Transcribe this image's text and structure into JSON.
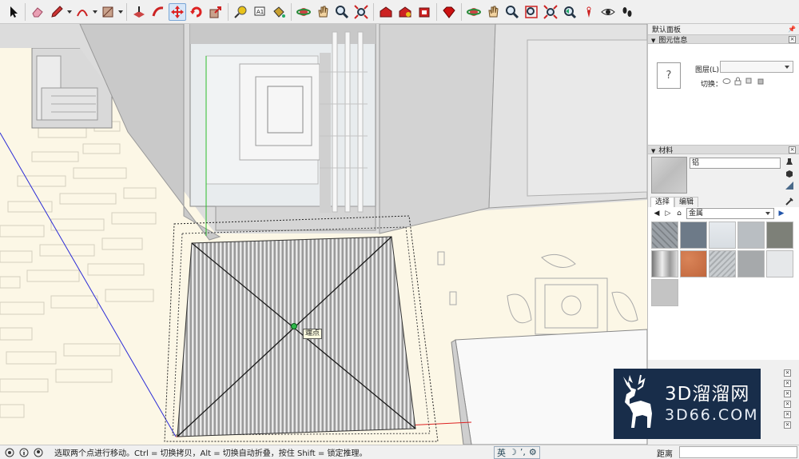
{
  "toolbar": {
    "tools": [
      {
        "name": "select-tool",
        "icon": "cursor-arrow-icon"
      },
      {
        "name": "eraser-tool",
        "icon": "eraser-icon"
      },
      {
        "name": "pencil-tool",
        "icon": "pencil-icon"
      },
      {
        "name": "arc-tool",
        "icon": "arc-icon"
      },
      {
        "name": "shape-tool",
        "icon": "rectangle-icon"
      },
      {
        "name": "push-pull-tool",
        "icon": "push-pull-icon"
      },
      {
        "name": "follow-me-tool",
        "icon": "follow-me-icon"
      },
      {
        "name": "move-tool",
        "icon": "move-arrows-icon",
        "active": true
      },
      {
        "name": "rotate-tool",
        "icon": "rotate-icon"
      },
      {
        "name": "scale-tool",
        "icon": "scale-icon"
      },
      {
        "name": "tape-measure-tool",
        "icon": "tape-measure-icon"
      },
      {
        "name": "text-tool",
        "icon": "text-label-icon"
      },
      {
        "name": "paint-bucket-tool",
        "icon": "paint-bucket-icon"
      },
      {
        "name": "orbit-tool",
        "icon": "orbit-icon"
      },
      {
        "name": "pan-tool",
        "icon": "hand-pan-icon"
      },
      {
        "name": "zoom-tool",
        "icon": "magnifier-icon"
      },
      {
        "name": "zoom-extents-tool",
        "icon": "zoom-extents-icon"
      },
      {
        "name": "warehouse-tool",
        "icon": "warehouse-icon"
      },
      {
        "name": "share-model-tool",
        "icon": "share-model-icon"
      },
      {
        "name": "extension-tool",
        "icon": "extension-icon"
      },
      {
        "name": "ruby-tool",
        "icon": "ruby-gem-icon"
      },
      {
        "name": "orbit-tool-2",
        "icon": "orbit-icon"
      },
      {
        "name": "pan-tool-2",
        "icon": "hand-pan-icon"
      },
      {
        "name": "zoom-tool-2",
        "icon": "magnifier-icon"
      },
      {
        "name": "zoom-window-tool",
        "icon": "zoom-window-icon"
      },
      {
        "name": "zoom-extents-tool-2",
        "icon": "zoom-extents-icon"
      },
      {
        "name": "previous-view-tool",
        "icon": "previous-view-icon"
      },
      {
        "name": "position-camera-tool",
        "icon": "position-camera-icon"
      },
      {
        "name": "look-around-tool",
        "icon": "eye-icon"
      },
      {
        "name": "walk-tool",
        "icon": "footprints-icon"
      }
    ]
  },
  "viewport": {
    "tooltip": "端点"
  },
  "panel": {
    "title": "默认面板",
    "entity_info": {
      "header": "图元信息",
      "thumb_symbol": "?",
      "layer_label": "图层(L):",
      "layer_value": "",
      "toggle_label": "切换："
    },
    "materials": {
      "header": "材料",
      "material_name": "铝",
      "tabs": [
        {
          "label": "选择",
          "active": true
        },
        {
          "label": "编辑",
          "active": false
        }
      ],
      "library": "金属",
      "swatches": [
        {
          "color": "#9aa0a6",
          "pattern": "diamond-plate"
        },
        {
          "color": "#6d7a88",
          "pattern": "denim-metal"
        },
        {
          "color": "#d8dde2",
          "pattern": "brushed"
        },
        {
          "color": "#b9bec2",
          "pattern": "plain"
        },
        {
          "color": "#7d8078",
          "pattern": "dark"
        },
        {
          "color": "#b8b8b8",
          "pattern": "cylinder"
        },
        {
          "color": "#c0663c",
          "pattern": "rust"
        },
        {
          "color": "#c9cdd0",
          "pattern": "tread"
        },
        {
          "color": "#a6a9ab",
          "pattern": "stone"
        },
        {
          "color": "#e6e8ea",
          "pattern": "light"
        },
        {
          "color": "#c4c4c4",
          "pattern": "aluminium"
        }
      ]
    }
  },
  "statusbar": {
    "message": "选取两个点进行移动。Ctrl = 切换拷贝，Alt = 切换自动折叠，按住 Shift = 锁定推理。",
    "ime_lang": "英",
    "measure_label": "距离",
    "measure_value": ""
  },
  "watermark": {
    "title": "3D溜溜网",
    "subtitle": "3D66.COM"
  }
}
